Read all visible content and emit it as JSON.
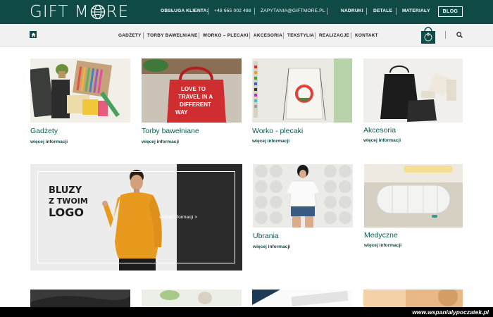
{
  "header": {
    "logo_text_1": "GIFT M",
    "logo_text_2": "RE",
    "customer_service_label": "OBSŁUGA KLIENTA:",
    "phone": "+48 665 002 488",
    "email": "ZAPYTANIA@GIFTMORE.PL",
    "links": [
      "NADRUKI",
      "DETALE",
      "MATERIAŁY"
    ],
    "blog_label": "BLOG"
  },
  "nav": {
    "items": [
      "GADŻETY",
      "TORBY BAWEŁNIANE",
      "WORKO – PLECAKI",
      "AKCESORIA",
      "TEKSTYLIA",
      "REALIZACJE",
      "KONTAKT"
    ],
    "cart_count": "0"
  },
  "cards": [
    {
      "title": "Gadżety",
      "more": "więcej informacji"
    },
    {
      "title": "Torby bawełniane",
      "more": "więcej informacji"
    },
    {
      "title": "Worko - plecaki",
      "more": "więcej informacji"
    },
    {
      "title": "Akcesoria",
      "more": "więcej informacji"
    },
    {
      "title": "Ubrania",
      "more": "więcej informacji"
    },
    {
      "title": "Medyczne",
      "more": "więcej informacji"
    }
  ],
  "banner": {
    "line1": "BLUZY",
    "line2": "Z TWOIM",
    "line3": "LOGO",
    "more": "więcej informacji >"
  },
  "bag_text": [
    "LOVE TO",
    "TRAVEL IN A",
    "DIFFERENT",
    "WAY"
  ],
  "watermark": "www.wspanialypoczatek.pl",
  "colors": {
    "brand": "#0f4a46",
    "accent_text": "#0f5b55"
  }
}
